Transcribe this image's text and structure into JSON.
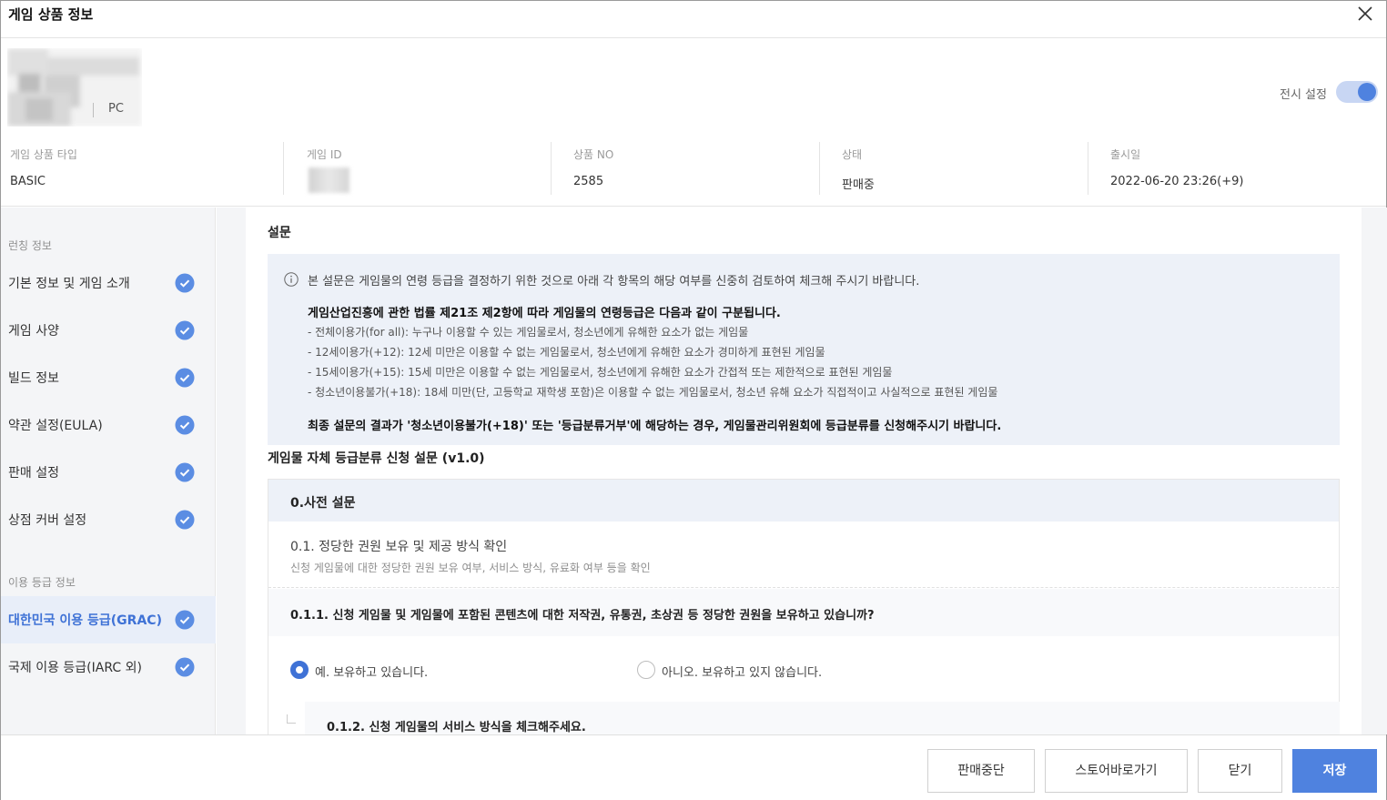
{
  "header": {
    "title": "게임 상품 정보"
  },
  "product": {
    "platform": "PC"
  },
  "display": {
    "label": "전시 설정",
    "enabled": true
  },
  "info": {
    "type": {
      "label": "게임 상품 타입",
      "value": "BASIC"
    },
    "game_id": {
      "label": "게임 ID"
    },
    "product_no": {
      "label": "상품 NO",
      "value": "2585"
    },
    "status": {
      "label": "상태",
      "value": "판매중"
    },
    "release": {
      "label": "출시일",
      "value": "2022-06-20 23:26(+9)"
    }
  },
  "sidebar": {
    "section1": "런칭 정보",
    "section2": "이용 등급 정보",
    "items": [
      {
        "label": "기본 정보 및 게임 소개"
      },
      {
        "label": "게임 사양"
      },
      {
        "label": "빌드 정보"
      },
      {
        "label": "약관 설정(EULA)"
      },
      {
        "label": "판매 설정"
      },
      {
        "label": "상점 커버 설정"
      },
      {
        "label": "대한민국 이용 등급(GRAC)"
      },
      {
        "label": "국제 이용 등급(IARC 외)"
      }
    ]
  },
  "main": {
    "section_title": "설문",
    "notice": {
      "intro": "본 설문은 게임물의 연령 등급을 결정하기 위한 것으로 아래 각 항목의 해당 여부를 신중히 검토하여 체크해 주시기 바랍니다.",
      "head": "게임산업진흥에 관한 법률 제21조 제2항에 따라 게임물의 연령등급은 다음과 같이 구분됩니다.",
      "lines": [
        "- 전체이용가(for all): 누구나 이용할 수 있는 게임물로서, 청소년에게 유해한 요소가 없는 게임물",
        "- 12세이용가(+12): 12세 미만은 이용할 수 없는 게임물로서, 청소년에게 유해한 요소가 경미하게 표현된 게임물",
        "- 15세이용가(+15): 15세 미만은 이용할 수 없는 게임물로서, 청소년에게 유해한 요소가 간접적 또는 제한적으로 표현된 게임물",
        "- 청소년이용불가(+18): 18세 미만(단, 고등학교 재학생 포함)은 이용할 수 없는 게임물로서, 청소년 유해 요소가 직접적이고 사실적으로 표현된 게임물"
      ],
      "final": "최종 설문의 결과가 '청소년이용불가(+18)' 또는 '등급분류거부'에 해당하는 경우, 게임물관리위원회에 등급분류를 신청해주시기 바랍니다."
    },
    "survey_title": "게임물 자체 등급분류 신청 설문 (v1.0)",
    "survey": {
      "section_head": "0.사전 설문",
      "sub_title": "0.1. 정당한 권원 보유 및 제공 방식 확인",
      "sub_desc": "신청 게임물에 대한 정당한 권원 보유 여부, 서비스 방식, 유료화 여부 등을 확인",
      "q1": "0.1.1. 신청 게임물 및 게임물에 포함된 콘텐츠에 대한 저작권, 유통권, 초상권 등 정당한 권원을 보유하고 있습니까?",
      "q1_yes": "예. 보유하고 있습니다.",
      "q1_no": "아니오. 보유하고 있지 않습니다.",
      "q2": "0.1.2. 신청 게임물의 서비스 방식을 체크해주세요."
    }
  },
  "footer": {
    "stop_sale": "판매중단",
    "store": "스토어바로가기",
    "close": "닫기",
    "save": "저장"
  },
  "colors": {
    "accent": "#4f82df",
    "check": "#5b8de3",
    "notice_bg": "#edf1f8"
  }
}
